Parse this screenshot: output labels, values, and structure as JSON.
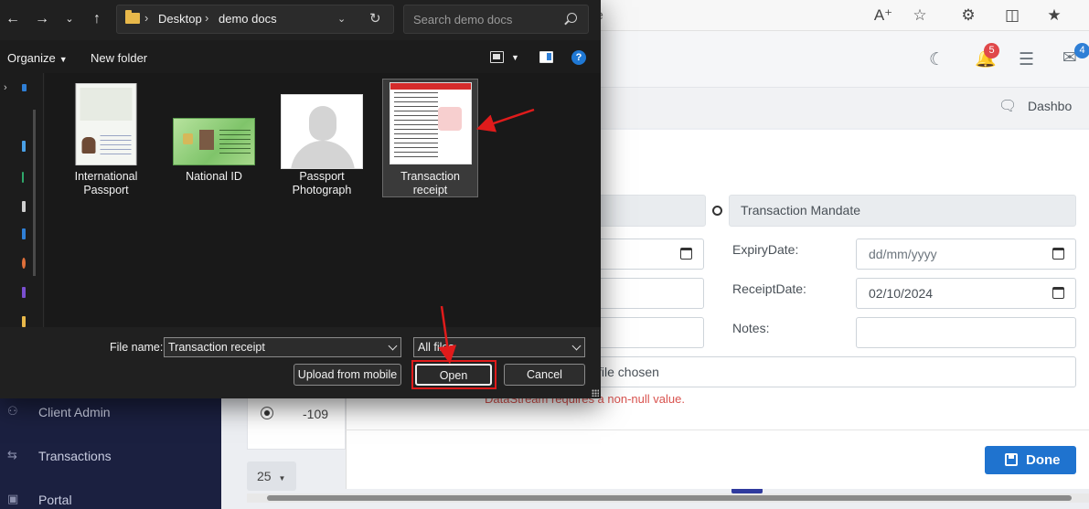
{
  "browser": {
    "url_tail": "e"
  },
  "app": {
    "notifications_count": "5",
    "messages_count": "4",
    "dashboard_label": "Dashbo",
    "sidebar": {
      "items": [
        {
          "label": "Client Admin",
          "icon": "users-icon"
        },
        {
          "label": "Transactions",
          "icon": "swap-icon"
        },
        {
          "label": "Portal",
          "icon": "portal-icon"
        }
      ]
    },
    "table": {
      "value": "-109"
    },
    "pager": {
      "page_size": "25"
    }
  },
  "modal": {
    "document_type_value": "Transaction Mandate",
    "expiry_label": "ExpiryDate:",
    "expiry_placeholder": "dd/mm/yyyy",
    "receipt_label": "ReceiptDate:",
    "receipt_value": "02/10/2024",
    "notes_label": "Notes:",
    "file_chosen_text": "file chosen",
    "error_text": "DataStream requires a non-null value.",
    "done_label": "Done"
  },
  "dialog": {
    "breadcrumb": [
      "Desktop",
      "demo docs"
    ],
    "search_placeholder": "Search demo docs",
    "toolbar": {
      "organize_label": "Organize",
      "new_folder_label": "New folder"
    },
    "files": [
      {
        "name": "International Passport",
        "thumb": "passport"
      },
      {
        "name": "National ID",
        "thumb": "national-id"
      },
      {
        "name": "Passport Photograph",
        "thumb": "photo"
      },
      {
        "name": "Transaction receipt",
        "thumb": "receipt",
        "selected": true
      }
    ],
    "filename_label": "File name:",
    "filename_value": "Transaction receipt",
    "filetype_value": "All files",
    "buttons": {
      "upload_mobile": "Upload from mobile",
      "open": "Open",
      "cancel": "Cancel"
    }
  },
  "colors": {
    "annotation_red": "#e01b1b",
    "done_blue": "#1f73cf",
    "sidebar_navy": "#1b2040"
  }
}
